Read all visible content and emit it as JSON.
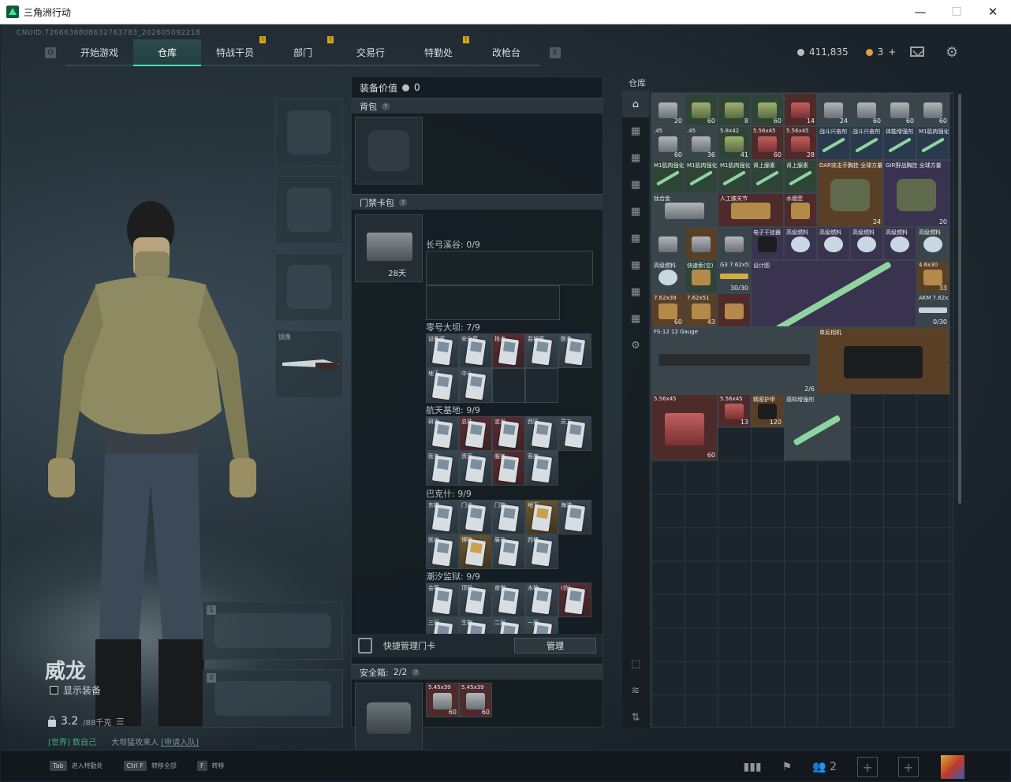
{
  "window": {
    "title": "三角洲行动",
    "minimize": "—",
    "maximize": "☐",
    "close": "✕"
  },
  "cnuid": "CNUID:7266636808632763783_202605092218",
  "nav": {
    "q_key": "Q",
    "e_key": "E",
    "tabs": [
      {
        "label": "开始游戏",
        "active": false,
        "flag": false
      },
      {
        "label": "仓库",
        "active": true,
        "flag": false
      },
      {
        "label": "特战干员",
        "active": false,
        "flag": true
      },
      {
        "label": "部门",
        "active": false,
        "flag": true
      },
      {
        "label": "交易行",
        "active": false,
        "flag": false
      },
      {
        "label": "特勤处",
        "active": false,
        "flag": true
      },
      {
        "label": "改枪台",
        "active": false,
        "flag": false
      }
    ],
    "flag_mark": "!"
  },
  "currency": {
    "silver": "411,835",
    "gold": "3",
    "gold_plus": "+"
  },
  "character": {
    "name": "威龙",
    "show_gear": "显示装备",
    "weight": "3.2",
    "weight_max": "/88千克",
    "chat_tag": "[世界]",
    "chat_user": "数自己",
    "chat_text": "大坝猛攻来人",
    "chat_link": "[申请入队]"
  },
  "gear_slots": {
    "melee_label": "镜像",
    "primary_num": "1",
    "secondary_num": "2"
  },
  "mid_panel": {
    "gear_value_label": "装备价值",
    "gear_value": "0",
    "backpack_label": "背包",
    "keycard_label": "门禁卡包",
    "keycard_days": "28天",
    "maps": [
      {
        "title": "长弓溪谷: 0/9"
      },
      {
        "title": "零号大坝: 7/9",
        "cards": [
          "设备室",
          "安全屋",
          "技术",
          "监控室",
          "医务",
          "地下",
          "中心"
        ]
      },
      {
        "title": "航天基地: 9/9",
        "cards": [
          "研发",
          "总装",
          "宣发",
          "西区",
          "员工",
          "医务",
          "资源",
          "服务",
          "客房"
        ]
      },
      {
        "title": "巴克什: 9/9",
        "cards": [
          "东楼",
          "门诊",
          "门控",
          "地下",
          "海洋",
          "医疗",
          "博物",
          "展览",
          "西楼"
        ]
      },
      {
        "title": "潮汐监狱: 9/9",
        "cards": [
          "会客",
          "顶层",
          "食堂",
          "水控",
          "(仿)",
          "三层",
          "生物",
          "二层",
          "一层"
        ]
      }
    ],
    "quick_manage": "快捷管理门卡",
    "manage_button": "管理",
    "safebox_label": "安全箱:",
    "safebox_count": "2/2",
    "safebox_items": [
      {
        "name": "5.45x39",
        "count": "60"
      },
      {
        "name": "5.45x39",
        "count": "60"
      }
    ]
  },
  "warehouse": {
    "title": "仓库",
    "items": [
      {
        "name": "",
        "count": "20",
        "color": "gray",
        "pic": "ammo-s"
      },
      {
        "name": "",
        "count": "60",
        "color": "green",
        "pic": "ammo-g"
      },
      {
        "name": "",
        "count": "8",
        "color": "green",
        "pic": "ammo-g"
      },
      {
        "name": "",
        "count": "60",
        "color": "green",
        "pic": "ammo-g"
      },
      {
        "name": "",
        "count": "14",
        "color": "red",
        "pic": "ammo-r"
      },
      {
        "name": "",
        "count": "24",
        "color": "gray",
        "pic": "ammo-s"
      },
      {
        "name": "",
        "count": "60",
        "color": "gray",
        "pic": "ammo-s"
      },
      {
        "name": "",
        "count": "60",
        "color": "gray",
        "pic": "ammo-s"
      },
      {
        "name": "",
        "count": "60",
        "color": "gray",
        "pic": "ammo-s"
      },
      {
        "name": ".45",
        "count": "60",
        "color": "gray",
        "pic": "ammo-s"
      },
      {
        "name": ".45",
        "count": "36",
        "color": "gray",
        "pic": "ammo-s"
      },
      {
        "name": "5.8x42",
        "count": "41",
        "color": "green",
        "pic": "ammo-g"
      },
      {
        "name": "5.56x45",
        "count": "60",
        "color": "red",
        "pic": "ammo-r"
      },
      {
        "name": "5.56x45",
        "count": "28",
        "color": "red",
        "pic": "ammo-r"
      },
      {
        "name": "战斗兴奋剂",
        "count": "",
        "color": "blue",
        "pic": "syringe"
      },
      {
        "name": "战斗兴奋剂",
        "count": "",
        "color": "blue",
        "pic": "syringe"
      },
      {
        "name": "体能增强剂",
        "count": "",
        "color": "blue",
        "pic": "syringe"
      },
      {
        "name": "M1肌肉强化",
        "count": "",
        "color": "blue",
        "pic": "syringe"
      },
      {
        "name": "M1肌肉强化",
        "count": "",
        "color": "green",
        "pic": "syringe"
      },
      {
        "name": "M1肌肉强化",
        "count": "",
        "color": "green",
        "pic": "syringe"
      },
      {
        "name": "M1肌肉强化",
        "count": "",
        "color": "green",
        "pic": "syringe"
      },
      {
        "name": "肾上腺素",
        "count": "",
        "color": "green",
        "pic": "syringe"
      },
      {
        "name": "肾上腺素",
        "count": "",
        "color": "green",
        "pic": "syringe"
      },
      {
        "name": "DAR突击手胸挂 全球方量",
        "count": "24",
        "color": "orange",
        "pic": "bag"
      },
      {
        "name": "GIR野战胸挂 全球方量",
        "count": "20",
        "color": "purple",
        "pic": "bag"
      },
      {
        "name": "钛合金",
        "count": "",
        "color": "gray",
        "pic": "ammo-s"
      },
      {
        "name": "人工膝关节",
        "count": "",
        "color": "red",
        "pic": "box"
      },
      {
        "name": "水烟壶",
        "count": "",
        "color": "red",
        "pic": "box"
      },
      {
        "name": "",
        "count": "",
        "color": "gray",
        "pic": "ammo-s"
      },
      {
        "name": "",
        "count": "",
        "color": "orange",
        "pic": "ammo-s"
      },
      {
        "name": "",
        "count": "",
        "color": "gray",
        "pic": "ammo-s"
      },
      {
        "name": "电子干扰器",
        "count": "",
        "color": "purple",
        "pic": "camera"
      },
      {
        "name": "高级燃料",
        "count": "",
        "color": "purple",
        "pic": "tin"
      },
      {
        "name": "高级燃料",
        "count": "",
        "color": "purple",
        "pic": "tin"
      },
      {
        "name": "高级燃料",
        "count": "",
        "color": "purple",
        "pic": "tin"
      },
      {
        "name": "高级燃料",
        "count": "",
        "color": "purple",
        "pic": "tin"
      },
      {
        "name": "高级燃料",
        "count": "",
        "color": "gray",
        "pic": "tin"
      },
      {
        "name": "高级燃料",
        "count": "",
        "color": "gray",
        "pic": "tin"
      },
      {
        "name": "快速索(空)",
        "count": "",
        "color": "green",
        "pic": "box"
      },
      {
        "name": "G3 7.62x51mm",
        "count": "30/30",
        "color": "gray",
        "pic": "gun"
      },
      {
        "name": "设计图",
        "count": "",
        "color": "purple",
        "pic": "syringe"
      },
      {
        "name": "4.6x30",
        "count": "33",
        "color": "orange",
        "pic": "box"
      },
      {
        "name": "7.62x39",
        "count": "60",
        "color": "orange",
        "pic": "box"
      },
      {
        "name": "7.62x51",
        "count": "43",
        "color": "orange",
        "pic": "box"
      },
      {
        "name": "",
        "count": "",
        "color": "red",
        "pic": "box"
      },
      {
        "name": "AKM 7.62x39mm",
        "count": "0/30",
        "color": "gray",
        "pic": "gun"
      },
      {
        "name": "FS-12 12 Gauge",
        "count": "2/6",
        "color": "gray",
        "pic": "gun"
      },
      {
        "name": "单反相机",
        "count": "",
        "color": "orange",
        "pic": "camera"
      },
      {
        "name": "5.56x45",
        "count": "60",
        "color": "red",
        "pic": "ammo-r"
      },
      {
        "name": "5.56x45",
        "count": "13",
        "color": "red",
        "pic": "ammo-r"
      },
      {
        "name": "精密护甲",
        "count": "120",
        "color": "orange",
        "pic": "camera"
      },
      {
        "name": "感知增强剂",
        "count": "",
        "color": "gray",
        "pic": "syringe"
      }
    ]
  },
  "bottom": {
    "hints": [
      {
        "key": "Tab",
        "text": "进入特勤处"
      },
      {
        "key": "Ctrl F",
        "text": "转移全部"
      },
      {
        "key": "F",
        "text": "转移"
      }
    ],
    "squad_count": "2"
  }
}
